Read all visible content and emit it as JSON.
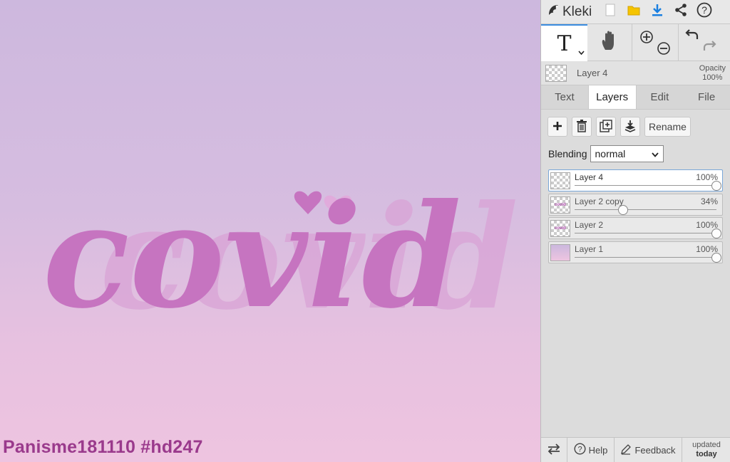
{
  "app": {
    "name": "Kleki"
  },
  "canvas": {
    "artwork_text": "covid",
    "watermark": "Panisme181110 #hd247"
  },
  "toolbar": {
    "text_tool_glyph": "T",
    "chevron": "⌄"
  },
  "current_layer": {
    "name": "Layer 4",
    "opacity_label": "Opacity",
    "opacity_value": "100%"
  },
  "tabs": [
    {
      "label": "Text"
    },
    {
      "label": "Layers"
    },
    {
      "label": "Edit"
    },
    {
      "label": "File"
    }
  ],
  "layers_panel": {
    "rename_label": "Rename",
    "blending_label": "Blending",
    "blending_value": "normal",
    "layers": [
      {
        "name": "Layer 4",
        "opacity": "100%",
        "opacity_fraction": 1.0
      },
      {
        "name": "Layer 2 copy",
        "opacity": "34%",
        "opacity_fraction": 0.34
      },
      {
        "name": "Layer 2",
        "opacity": "100%",
        "opacity_fraction": 1.0
      },
      {
        "name": "Layer 1",
        "opacity": "100%",
        "opacity_fraction": 1.0
      }
    ]
  },
  "bottom_bar": {
    "help_label": "Help",
    "feedback_label": "Feedback",
    "updated_label": "updated",
    "updated_value": "today"
  },
  "colors": {
    "accent": "#3b8de0",
    "artwork_main": "#c674c0",
    "artwork_ghost": "#d9a3d6",
    "watermark": "#9a3a8c"
  }
}
